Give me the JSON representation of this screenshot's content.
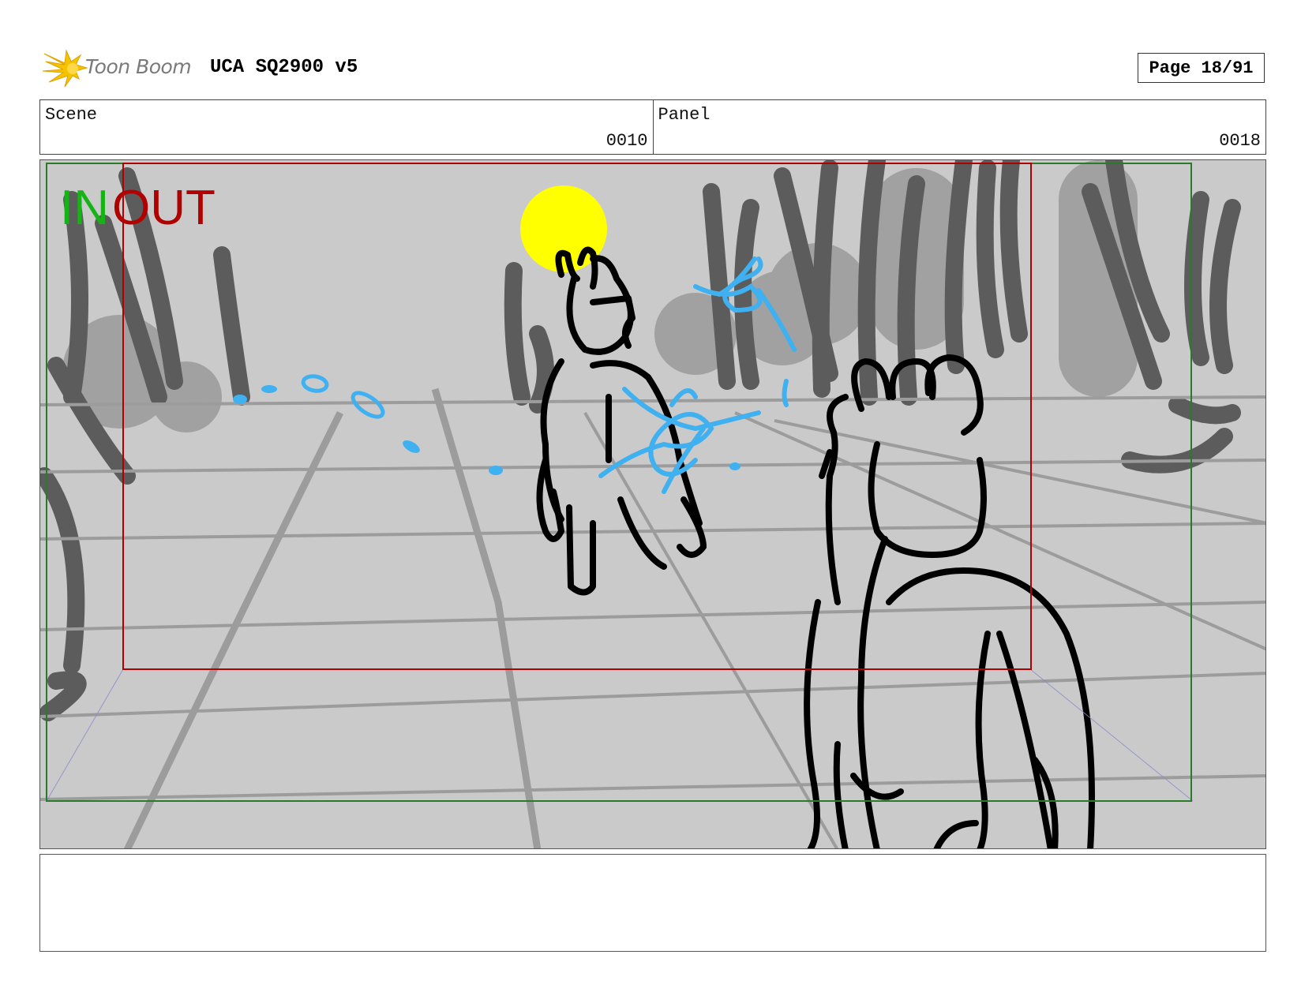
{
  "header": {
    "logo_text": "Toon Boom",
    "title": "UCA SQ2900 v5",
    "page_label": "Page 18/91"
  },
  "info": {
    "scene_label": "Scene",
    "scene_value": "0010",
    "panel_label": "Panel",
    "panel_value": "0018"
  },
  "frame": {
    "in_label": "IN",
    "out_label": "OUT"
  },
  "notes": {
    "text": ""
  },
  "colors": {
    "logo_star": "#f5c400",
    "in_green": "#16b316",
    "out_red": "#b00000",
    "sun_yellow": "#ffff00",
    "effect_blue": "#3fb0f0",
    "background_gray": "#cacaca"
  }
}
